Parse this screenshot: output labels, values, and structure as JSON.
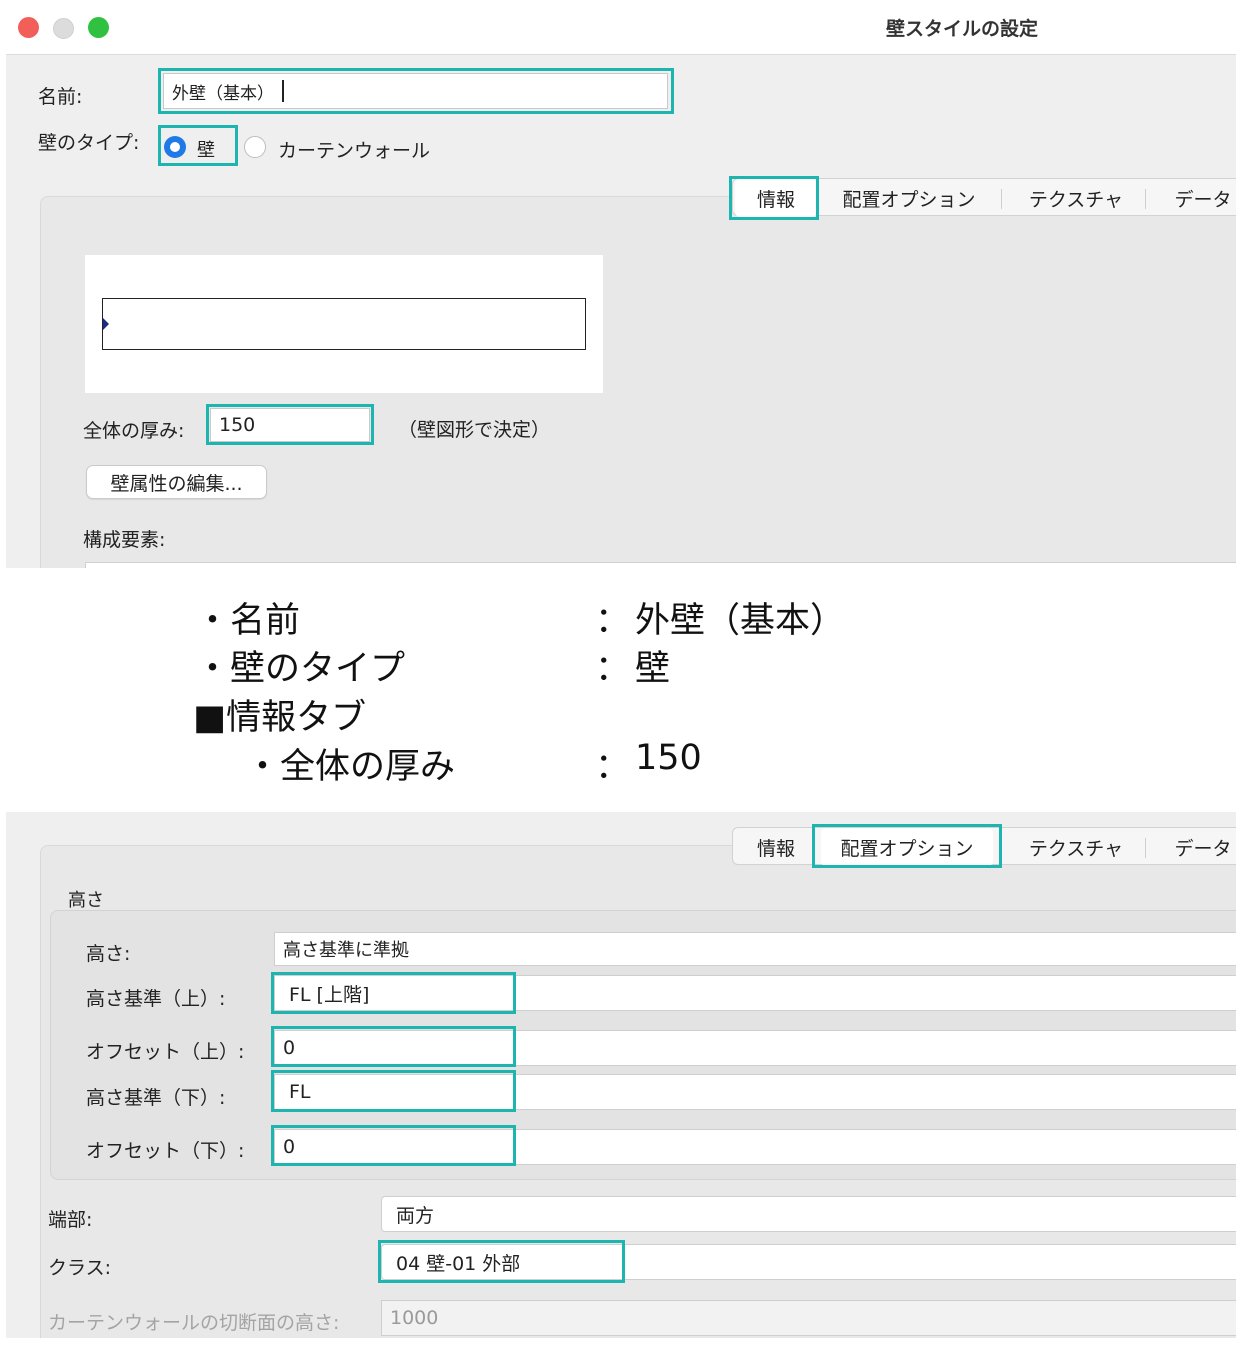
{
  "window1": {
    "title": "壁スタイルの設定",
    "name_label": "名前:",
    "name_value": "外壁（基本）",
    "wall_type_label": "壁のタイプ:",
    "wall_type_options": [
      "壁",
      "カーテンウォール"
    ],
    "wall_type_selected": "壁",
    "tabs": [
      "情報",
      "配置オプション",
      "テクスチャ",
      "データ"
    ],
    "selected_tab": "情報",
    "thickness_label": "全体の厚み:",
    "thickness_value": "150",
    "thickness_note": "（壁図形で決定）",
    "edit_button": "壁属性の編集...",
    "components_label": "構成要素:"
  },
  "summary": {
    "rows": [
      {
        "label": "・名前",
        "sep": "：",
        "value": "外壁（基本）"
      },
      {
        "label": "・壁のタイプ",
        "sep": "：",
        "value": "壁"
      },
      {
        "label": "■情報タブ",
        "sep": "",
        "value": ""
      },
      {
        "label": "・全体の厚み",
        "sep": "：",
        "value": "150"
      }
    ]
  },
  "window2": {
    "tabs": [
      "情報",
      "配置オプション",
      "テクスチャ",
      "データ"
    ],
    "selected_tab": "配置オプション",
    "height_group_label": "高さ",
    "fields": [
      {
        "label": "高さ:",
        "value": "高さ基準に準拠"
      },
      {
        "label": "高さ基準（上）:",
        "value": "FL [上階]"
      },
      {
        "label": "オフセット（上）:",
        "value": "0"
      },
      {
        "label": "高さ基準（下）:",
        "value": "FL"
      },
      {
        "label": "オフセット（下）:",
        "value": "0"
      }
    ],
    "end_label": "端部:",
    "end_value": "両方",
    "class_label": "クラス:",
    "class_value": "04 壁-01 外部",
    "curtain_label": "カーテンウォールの切断面の高さ:",
    "curtain_value": "1000"
  },
  "colors": {
    "highlight": "#1eb5b1",
    "radio_selected": "#1f7ae8"
  }
}
